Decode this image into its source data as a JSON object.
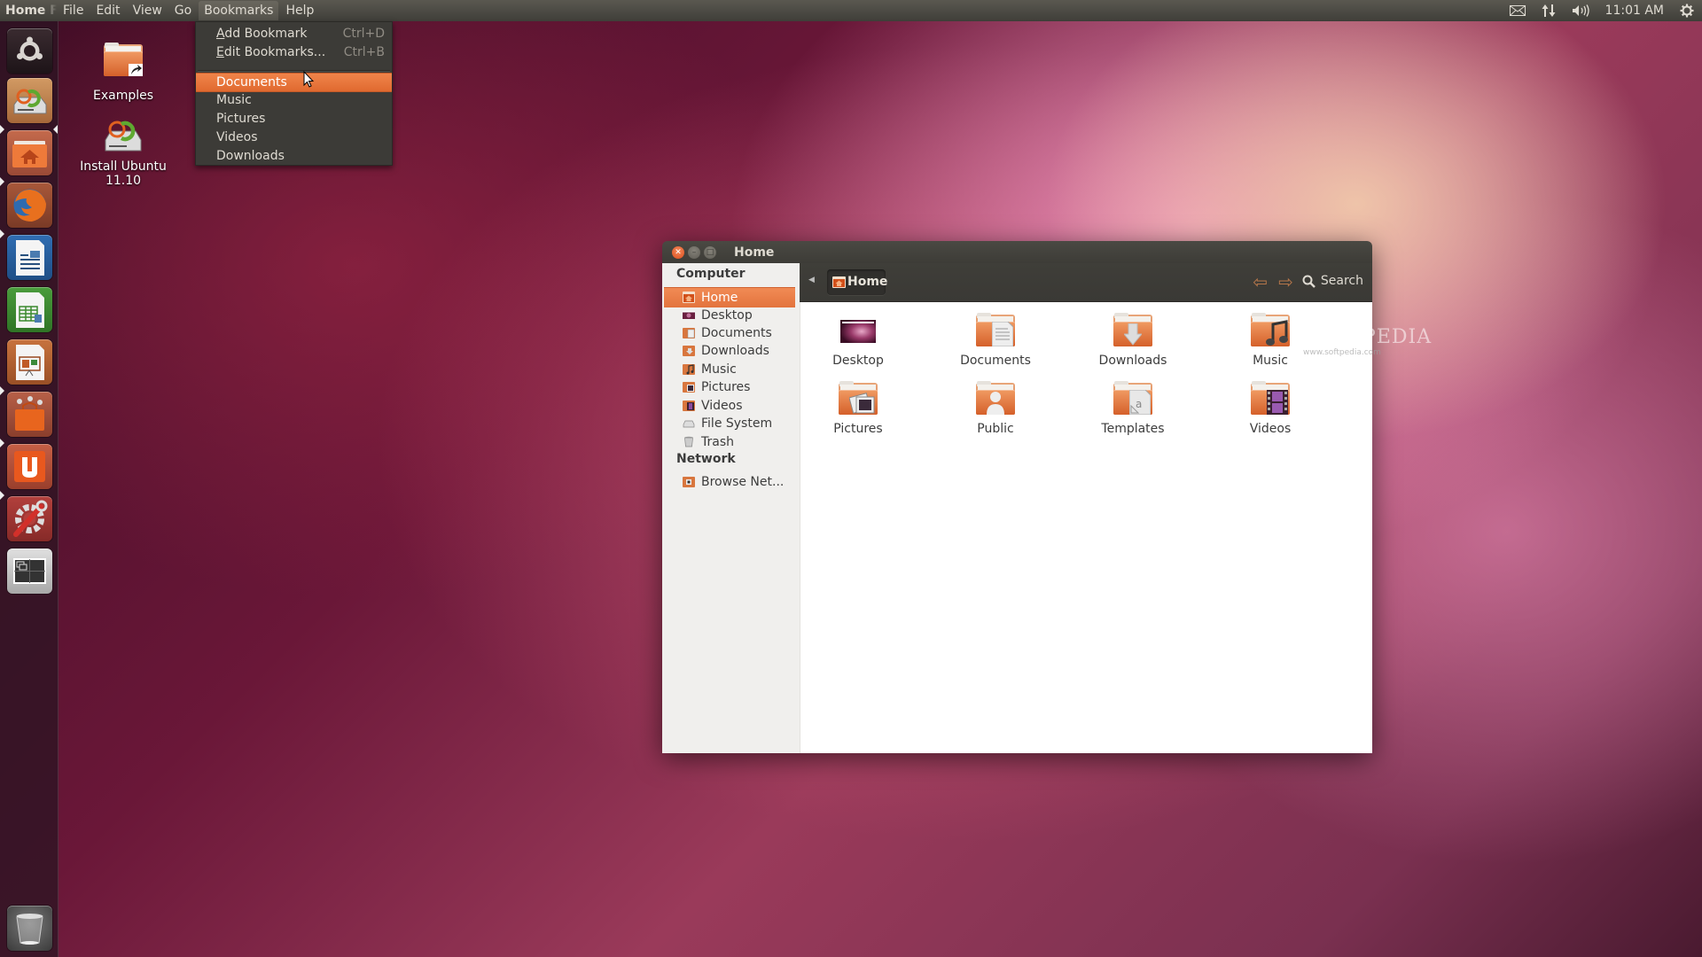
{
  "top_panel": {
    "app_title": "Home Folder",
    "menus": [
      "File",
      "Edit",
      "View",
      "Go",
      "Bookmarks",
      "Help"
    ],
    "open_menu": "Bookmarks",
    "indicators": {
      "mail": "mail-icon",
      "network": "network-icon",
      "volume": "volume-icon",
      "clock": "11:01 AM",
      "session": "power-gear-icon"
    }
  },
  "bookmarks_menu": {
    "items": [
      {
        "label": "Add Bookmark",
        "mnemonic": "A",
        "rest": "dd Bookmark",
        "shortcut": "Ctrl+D"
      },
      {
        "label": "Edit Bookmarks...",
        "mnemonic": "E",
        "rest": "dit Bookmarks...",
        "shortcut": "Ctrl+B"
      }
    ],
    "places": [
      "Documents",
      "Music",
      "Pictures",
      "Videos",
      "Downloads"
    ],
    "highlighted": "Documents"
  },
  "launcher": {
    "items": [
      {
        "name": "Dash Home",
        "icon": "ubuntu-logo-icon"
      },
      {
        "name": "Install Ubuntu 11.10",
        "icon": "installer-icon"
      },
      {
        "name": "Home Folder",
        "icon": "home-folder-icon",
        "running": true,
        "active": true
      },
      {
        "name": "Firefox Web Browser",
        "icon": "firefox-icon",
        "running": true
      },
      {
        "name": "LibreOffice Writer",
        "icon": "writer-icon",
        "running": true
      },
      {
        "name": "LibreOffice Calc",
        "icon": "calc-icon"
      },
      {
        "name": "LibreOffice Impress",
        "icon": "impress-icon"
      },
      {
        "name": "Ubuntu Software Center",
        "icon": "software-center-icon",
        "running": true
      },
      {
        "name": "Ubuntu One",
        "icon": "ubuntu-one-icon",
        "running": true
      },
      {
        "name": "System Settings",
        "icon": "settings-icon",
        "running": true
      },
      {
        "name": "Workspace Switcher",
        "icon": "workspace-switcher-icon"
      },
      {
        "name": "Trash",
        "icon": "trash-icon"
      }
    ]
  },
  "desktop": {
    "icons": [
      {
        "label": "Examples",
        "icon": "folder-link-icon"
      },
      {
        "label": "Install Ubuntu 11.10",
        "icon": "installer-icon"
      }
    ]
  },
  "window": {
    "title": "Home",
    "sidebar": {
      "sections": [
        {
          "heading": "Computer",
          "items": [
            {
              "label": "Home",
              "icon": "home-folder-icon",
              "selected": true
            },
            {
              "label": "Desktop",
              "icon": "desktop-icon"
            },
            {
              "label": "Documents",
              "icon": "documents-folder-icon"
            },
            {
              "label": "Downloads",
              "icon": "downloads-folder-icon"
            },
            {
              "label": "Music",
              "icon": "music-folder-icon"
            },
            {
              "label": "Pictures",
              "icon": "pictures-folder-icon"
            },
            {
              "label": "Videos",
              "icon": "videos-folder-icon"
            },
            {
              "label": "File System",
              "icon": "drive-icon"
            },
            {
              "label": "Trash",
              "icon": "trash-icon"
            }
          ]
        },
        {
          "heading": "Network",
          "items": [
            {
              "label": "Browse Net...",
              "icon": "network-folder-icon"
            }
          ]
        }
      ]
    },
    "toolbar": {
      "breadcrumb": "Home",
      "search_label": "Search"
    },
    "files": [
      {
        "label": "Desktop",
        "icon": "desktop-icon"
      },
      {
        "label": "Documents",
        "icon": "documents-folder-icon"
      },
      {
        "label": "Downloads",
        "icon": "downloads-folder-icon"
      },
      {
        "label": "Music",
        "icon": "music-folder-icon"
      },
      {
        "label": "Pictures",
        "icon": "pictures-folder-icon"
      },
      {
        "label": "Public",
        "icon": "public-folder-icon"
      },
      {
        "label": "Templates",
        "icon": "templates-folder-icon"
      },
      {
        "label": "Videos",
        "icon": "videos-folder-icon"
      }
    ]
  },
  "watermark": {
    "text": "SOFTPEDIA",
    "url": "www.softpedia.com"
  },
  "colors": {
    "accent": "#e9773d",
    "panel": "#3c3b37",
    "sidebar": "#f0efed"
  }
}
